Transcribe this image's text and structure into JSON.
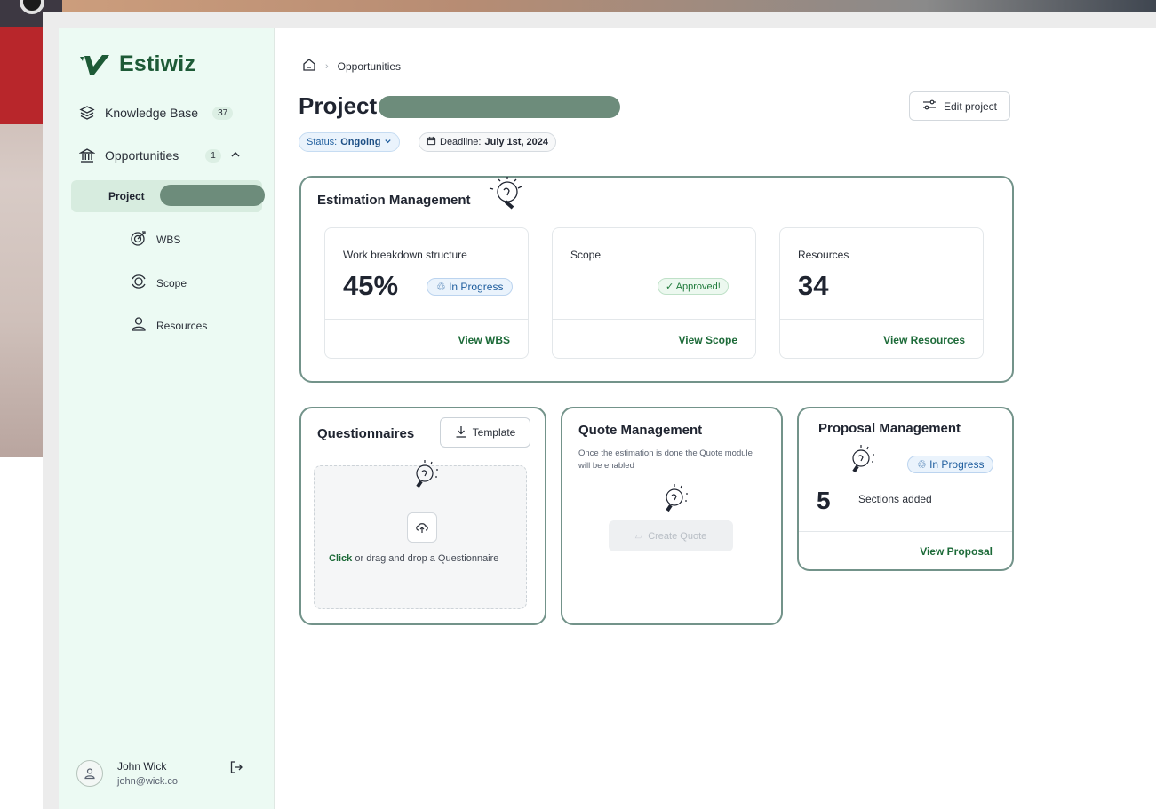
{
  "app": {
    "name": "Estiwiz"
  },
  "sidebar": {
    "items": [
      {
        "label": "Knowledge Base",
        "count": "37",
        "icon": "layers-icon"
      },
      {
        "label": "Opportunities",
        "count": "1",
        "icon": "bank-icon"
      }
    ],
    "active_project_label": "Project",
    "sub_items": [
      {
        "label": "WBS",
        "icon": "target-icon"
      },
      {
        "label": "Scope",
        "icon": "radar-icon"
      },
      {
        "label": "Resources",
        "icon": "person-icon"
      }
    ]
  },
  "user": {
    "name": "John Wick",
    "email": "john@wick.co"
  },
  "breadcrumb": {
    "current": "Opportunities"
  },
  "header": {
    "title": "Project",
    "edit_label": "Edit project",
    "status_prefix": "Status:",
    "status_value": "Ongoing",
    "deadline_prefix": "Deadline:",
    "deadline_value": "July 1st, 2024"
  },
  "estimation": {
    "title": "Estimation Management",
    "cards": [
      {
        "label": "Work breakdown structure",
        "value": "45%",
        "tag": "In Progress",
        "link": "View WBS"
      },
      {
        "label": "Scope",
        "value": "",
        "tag": "Approved!",
        "link": "View Scope"
      },
      {
        "label": "Resources",
        "value": "34",
        "tag": "",
        "link": "View Resources"
      }
    ]
  },
  "questionnaires": {
    "title": "Questionnaires",
    "template_label": "Template",
    "drop_click": "Click",
    "drop_rest": "or drag and drop a Questionnaire"
  },
  "quote": {
    "title": "Quote Management",
    "note": "Once the estimation is done the Quote module will be enabled",
    "button": "Create Quote"
  },
  "proposal": {
    "title": "Proposal Management",
    "tag": "In Progress",
    "count": "5",
    "count_label": "Sections added",
    "link": "View Proposal"
  },
  "colors": {
    "brand": "#1d5a36",
    "sidebar_bg": "#ecfaf3",
    "card_border": "#73938a",
    "link_green": "#1c6a38",
    "info_blue": "#1f5e9e"
  }
}
